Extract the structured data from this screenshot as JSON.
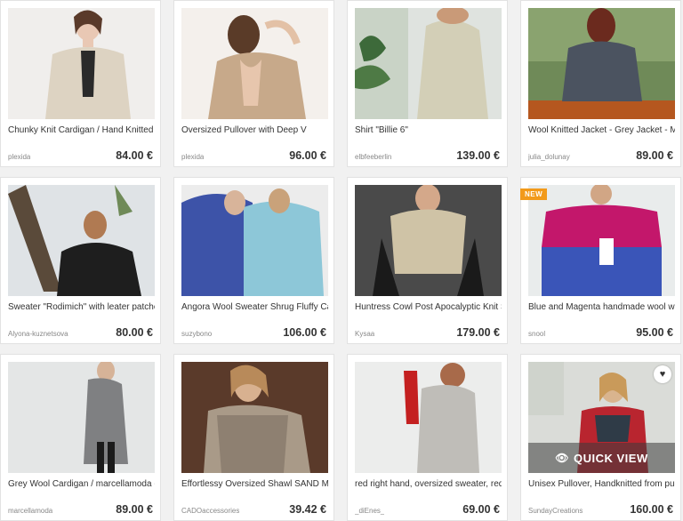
{
  "products": [
    {
      "title": "Chunky Knit Cardigan / Hand Knitted",
      "shop": "plexida",
      "price": "84.00 €"
    },
    {
      "title": "Oversized Pullover with Deep V",
      "shop": "plexida",
      "price": "96.00 €"
    },
    {
      "title": "Shirt \"Billie 6\"",
      "shop": "elbfeeberlin",
      "price": "139.00 €"
    },
    {
      "title": "Wool Knitted Jacket - Grey Jacket - Me",
      "shop": "julia_dolunay",
      "price": "89.00 €"
    },
    {
      "title": "Sweater \"Rodimich\" with leater patche",
      "shop": "Alyona-kuznetsova",
      "price": "80.00 €"
    },
    {
      "title": "Angora Wool Sweater Shrug Fluffy Ca",
      "shop": "suzybono",
      "price": "106.00 €"
    },
    {
      "title": "Huntress Cowl Post Apocalyptic Knit S",
      "shop": "Kysaa",
      "price": "179.00 €"
    },
    {
      "title": "Blue and Magenta handmade wool wi",
      "shop": "snool",
      "price": "95.00 €",
      "badge": "NEW"
    },
    {
      "title": "Grey Wool Cardigan / marcellamoda -",
      "shop": "marcellamoda",
      "price": "89.00 €"
    },
    {
      "title": "Effortlessy Oversized Shawl SAND Me",
      "shop": "CADOaccessories",
      "price": "39.42 €"
    },
    {
      "title": "red right hand, oversized sweater, red",
      "shop": "_diEnes_",
      "price": "69.00 €"
    },
    {
      "title": "Unisex Pullover, Handknitted from pur",
      "shop": "SundayCreations",
      "price": "160.00 €",
      "quick_view": "QUICK VIEW"
    }
  ],
  "icons": {
    "heart": "heart-icon",
    "eye": "eye-icon"
  },
  "colors": {
    "background": "#f1f1f1",
    "badge": "#f29a1a"
  }
}
